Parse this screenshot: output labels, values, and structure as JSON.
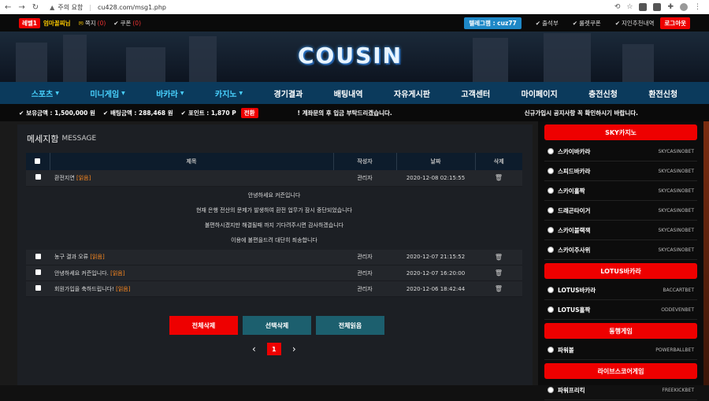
{
  "browser": {
    "security_label": "주의 요함",
    "url": "cu428.com/msg1.php"
  },
  "topbar": {
    "level": "레벨1",
    "nickname": "엄마꼴찌님",
    "notes_label": "쪽지",
    "notes_count": "(0)",
    "coupon_label": "쿠폰",
    "coupon_count": "(0)",
    "telegram": "텔레그램 : cuz77",
    "attendance": "출석부",
    "roulette": "룰렛쿠폰",
    "referral": "지인추천내역",
    "logout": "로그아웃"
  },
  "banner": {
    "logo": "COUSIN"
  },
  "menu": [
    {
      "label": "스포츠",
      "caret": true,
      "highlight": true
    },
    {
      "label": "미니게임",
      "caret": true,
      "highlight": true
    },
    {
      "label": "바카라",
      "caret": true,
      "highlight": true
    },
    {
      "label": "카지노",
      "caret": true,
      "highlight": true
    },
    {
      "label": "경기결과",
      "caret": false,
      "highlight": false
    },
    {
      "label": "배팅내역",
      "caret": false,
      "highlight": false
    },
    {
      "label": "자유게시판",
      "caret": false,
      "highlight": false
    },
    {
      "label": "고객센터",
      "caret": false,
      "highlight": false
    },
    {
      "label": "마이페이지",
      "caret": false,
      "highlight": false
    },
    {
      "label": "충전신청",
      "caret": false,
      "highlight": false
    },
    {
      "label": "환전신청",
      "caret": false,
      "highlight": false
    }
  ],
  "status": {
    "balance": "보유금액 : 1,500,000 원",
    "bet_amount": "배팅금액 : 288,468 원",
    "points": "포인트 : 1,870 P",
    "convert": "전환",
    "notice1": "! 계좌문의 후 입금 부탁드리겠습니다.",
    "notice2": "신규가입시 공지사항 꼭 확인하시기 바랍니다."
  },
  "page": {
    "title": "메세지함",
    "subtitle": "MESSAGE"
  },
  "table": {
    "headers": [
      "제목",
      "작성자",
      "날짜",
      "삭제"
    ],
    "rows": [
      {
        "title": "환전지연",
        "tag": "[읽음]",
        "author": "관리자",
        "date": "2020-12-08 02:15:55"
      },
      {
        "title": "농구 결과 오류",
        "tag": "[읽음]",
        "author": "관리자",
        "date": "2020-12-07 21:15:52"
      },
      {
        "title": "안녕하세요 커즌입니다.",
        "tag": "[읽음]",
        "author": "관리자",
        "date": "2020-12-07 16:20:00"
      },
      {
        "title": "회원가입을 축하드립니다!",
        "tag": "[읽음]",
        "author": "관리자",
        "date": "2020-12-06 18:42:44"
      }
    ],
    "message_lines": [
      "안녕하세요 커즌입니다",
      "현재 은행 전산의 문제가 발생하여 환전 업무가 잠시 중단되었습니다",
      "불편하시겠지만 해결될때 까지 기다려주시면 감사하겠습니다",
      "이용에 불편을드려 대단히 죄송합니다"
    ]
  },
  "actions": {
    "delete_all": "전체삭제",
    "delete_selected": "선택삭제",
    "read_all": "전체읽음"
  },
  "pagination": {
    "current": "1",
    "prev": "‹",
    "next": "›"
  },
  "sidebar": {
    "sections": [
      {
        "head": "SKY카지노",
        "items": [
          {
            "label": "스카이바카라",
            "sub": "SKYCASINOBET"
          },
          {
            "label": "스피드바카라",
            "sub": "SKYCASINOBET"
          },
          {
            "label": "스카이홀짝",
            "sub": "SKYCASINOBET"
          },
          {
            "label": "드래곤타이거",
            "sub": "SKYCASINOBET"
          },
          {
            "label": "스카이블랙잭",
            "sub": "SKYCASINOBET"
          },
          {
            "label": "스카이주사위",
            "sub": "SKYCASINOBET"
          }
        ]
      },
      {
        "head": "LOTUS바카라",
        "items": [
          {
            "label": "LOTUS바카라",
            "sub": "BACCARTBET"
          },
          {
            "label": "LOTUS홀짝",
            "sub": "ODDEVENBET"
          }
        ]
      },
      {
        "head": "동행게임",
        "items": [
          {
            "label": "파워볼",
            "sub": "POWERBALLBET"
          }
        ]
      },
      {
        "head": "라이브스코어게임",
        "items": [
          {
            "label": "파워프리킥",
            "sub": "FREEKICKBET"
          }
        ]
      }
    ]
  }
}
